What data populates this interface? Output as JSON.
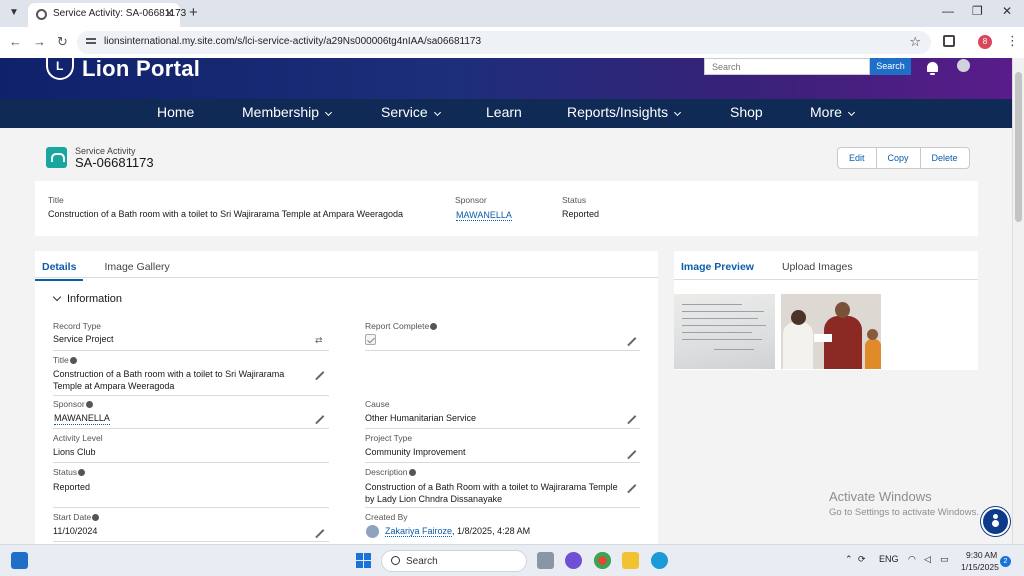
{
  "browser": {
    "tab_title": "Service Activity: SA-06681173",
    "url": "lionsinternational.my.site.com/s/lci-service-activity/a29Ns000006tg4nIAA/sa06681173",
    "profile_initial": "8"
  },
  "site": {
    "logo_text": "Lion Portal",
    "search_placeholder": "Search",
    "search_button": "Search",
    "nav": [
      "Home",
      "Membership",
      "Service",
      "Learn",
      "Reports/Insights",
      "Shop",
      "More"
    ]
  },
  "record": {
    "type_label": "Service Activity",
    "name": "SA-06681173",
    "actions": [
      "Edit",
      "Copy",
      "Delete"
    ]
  },
  "highlights": {
    "title_label": "Title",
    "title_value": "Construction of a Bath room with a toilet to Sri Wajirarama Temple at Ampara Weeragoda",
    "sponsor_label": "Sponsor",
    "sponsor_value": "MAWANELLA",
    "status_label": "Status",
    "status_value": "Reported"
  },
  "left_tabs": [
    "Details",
    "Image Gallery"
  ],
  "right_tabs": [
    "Image Preview",
    "Upload Images"
  ],
  "section_title": "Information",
  "fields": {
    "record_type": {
      "label": "Record Type",
      "value": "Service Project"
    },
    "report_complete": {
      "label": "Report Complete",
      "checked": true
    },
    "title": {
      "label": "Title",
      "value": "Construction of a Bath room with a toilet to Sri Wajirarama Temple at Ampara Weeragoda"
    },
    "sponsor": {
      "label": "Sponsor",
      "value": "MAWANELLA"
    },
    "cause": {
      "label": "Cause",
      "value": "Other Humanitarian Service"
    },
    "activity_level": {
      "label": "Activity Level",
      "value": "Lions Club"
    },
    "project_type": {
      "label": "Project Type",
      "value": "Community Improvement"
    },
    "status": {
      "label": "Status",
      "value": "Reported"
    },
    "description": {
      "label": "Description",
      "value": "Construction of a Bath Room with a toilet to Wajirarama Temple by Lady Lion Chndra Dissanayake"
    },
    "start_date": {
      "label": "Start Date",
      "value": "11/10/2024"
    },
    "created_by": {
      "label": "Created By",
      "user": "Zakariya Fairoze",
      "date": ", 1/8/2025, 4:28 AM"
    }
  },
  "watermark": {
    "line1": "Activate Windows",
    "line2": "Go to Settings to activate Windows."
  },
  "taskbar": {
    "search_label": "Search",
    "lang": "ENG",
    "time": "9:30 AM",
    "date": "1/15/2025",
    "notification_count": "2",
    "chrome_badge": "8"
  },
  "colors": {
    "nav_bg": "#0e2a55",
    "link": "#0b5cab",
    "record_icon": "#19a6a0",
    "search_button": "#1f6fc9"
  }
}
